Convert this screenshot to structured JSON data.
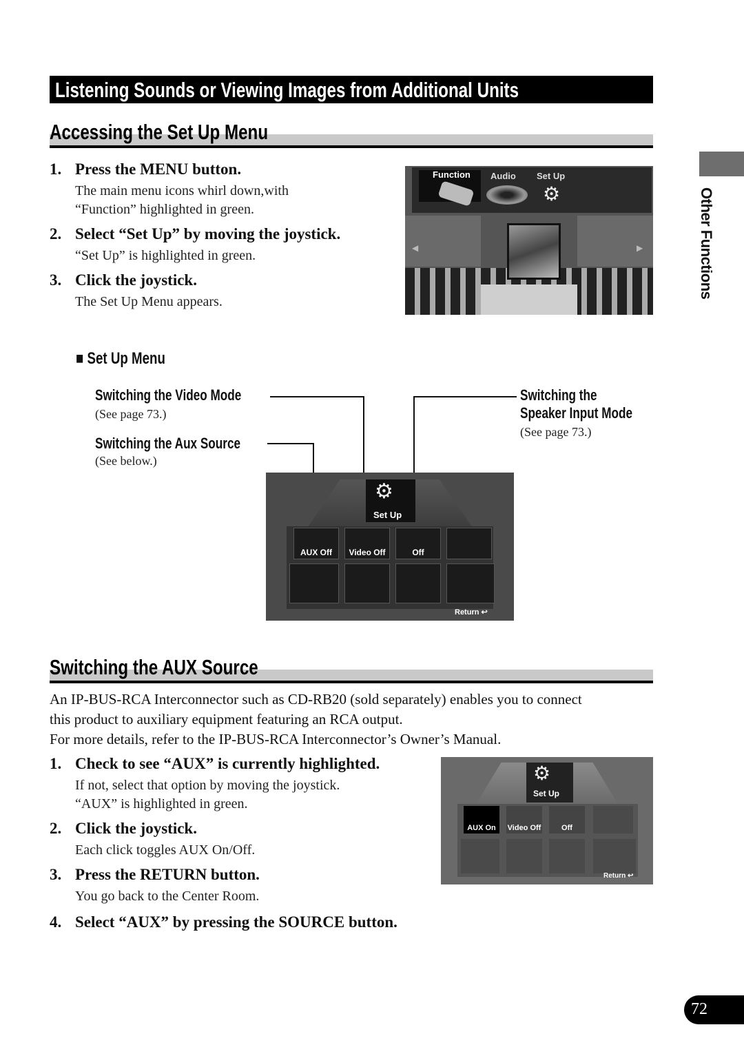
{
  "banner": {
    "title": "Listening Sounds or Viewing Images from Additional Units"
  },
  "section1": {
    "title": "Accessing the Set Up Menu",
    "steps": [
      {
        "num": "1.",
        "heading": "Press the MENU button.",
        "lines": [
          "The main menu icons whirl down,with",
          "“Function” highlighted in green."
        ]
      },
      {
        "num": "2.",
        "heading": "Select “Set Up” by moving the joystick.",
        "lines": [
          "“Set Up” is highlighted in green."
        ]
      },
      {
        "num": "3.",
        "heading": "Click the joystick.",
        "lines": [
          "The Set Up Menu appears."
        ]
      }
    ],
    "screen": {
      "menu_items": [
        "Function",
        "Audio",
        "Set Up"
      ],
      "highlighted": "Function"
    }
  },
  "setup_menu": {
    "heading": "Set Up Menu",
    "callouts": {
      "video": {
        "title": "Switching the Video Mode",
        "ref": "(See page 73.)"
      },
      "aux": {
        "title": "Switching the Aux Source",
        "ref": "(See below.)"
      },
      "speaker": {
        "title_line1": "Switching the",
        "title_line2": "Speaker Input Mode",
        "ref": "(See page 73.)"
      }
    },
    "screen": {
      "title": "Set Up",
      "tiles": [
        "AUX Off",
        "Video Off",
        "Off"
      ],
      "return_label": "Return"
    }
  },
  "section2": {
    "title": "Switching the AUX Source",
    "intro": [
      "An IP-BUS-RCA Interconnector such as CD-RB20 (sold separately) enables you to connect",
      "this product to auxiliary equipment featuring an RCA output.",
      "For more details, refer to the IP-BUS-RCA Interconnector’s Owner’s Manual."
    ],
    "steps": [
      {
        "num": "1.",
        "heading": "Check to see “AUX” is currently highlighted.",
        "lines": [
          "If not, select that option by moving the joystick.",
          "“AUX” is highlighted in green."
        ]
      },
      {
        "num": "2.",
        "heading": "Click the joystick.",
        "lines": [
          "Each click toggles AUX On/Off."
        ]
      },
      {
        "num": "3.",
        "heading": "Press the RETURN button.",
        "lines": [
          "You go back to the Center Room."
        ]
      },
      {
        "num": "4.",
        "heading": "Select “AUX” by pressing the SOURCE button.",
        "lines": []
      }
    ],
    "screen": {
      "title": "Set Up",
      "tiles": [
        "AUX On",
        "Video Off",
        "Off"
      ],
      "return_label": "Return"
    }
  },
  "side_tab": {
    "label": "Other Functions"
  },
  "page": {
    "number": "72"
  }
}
